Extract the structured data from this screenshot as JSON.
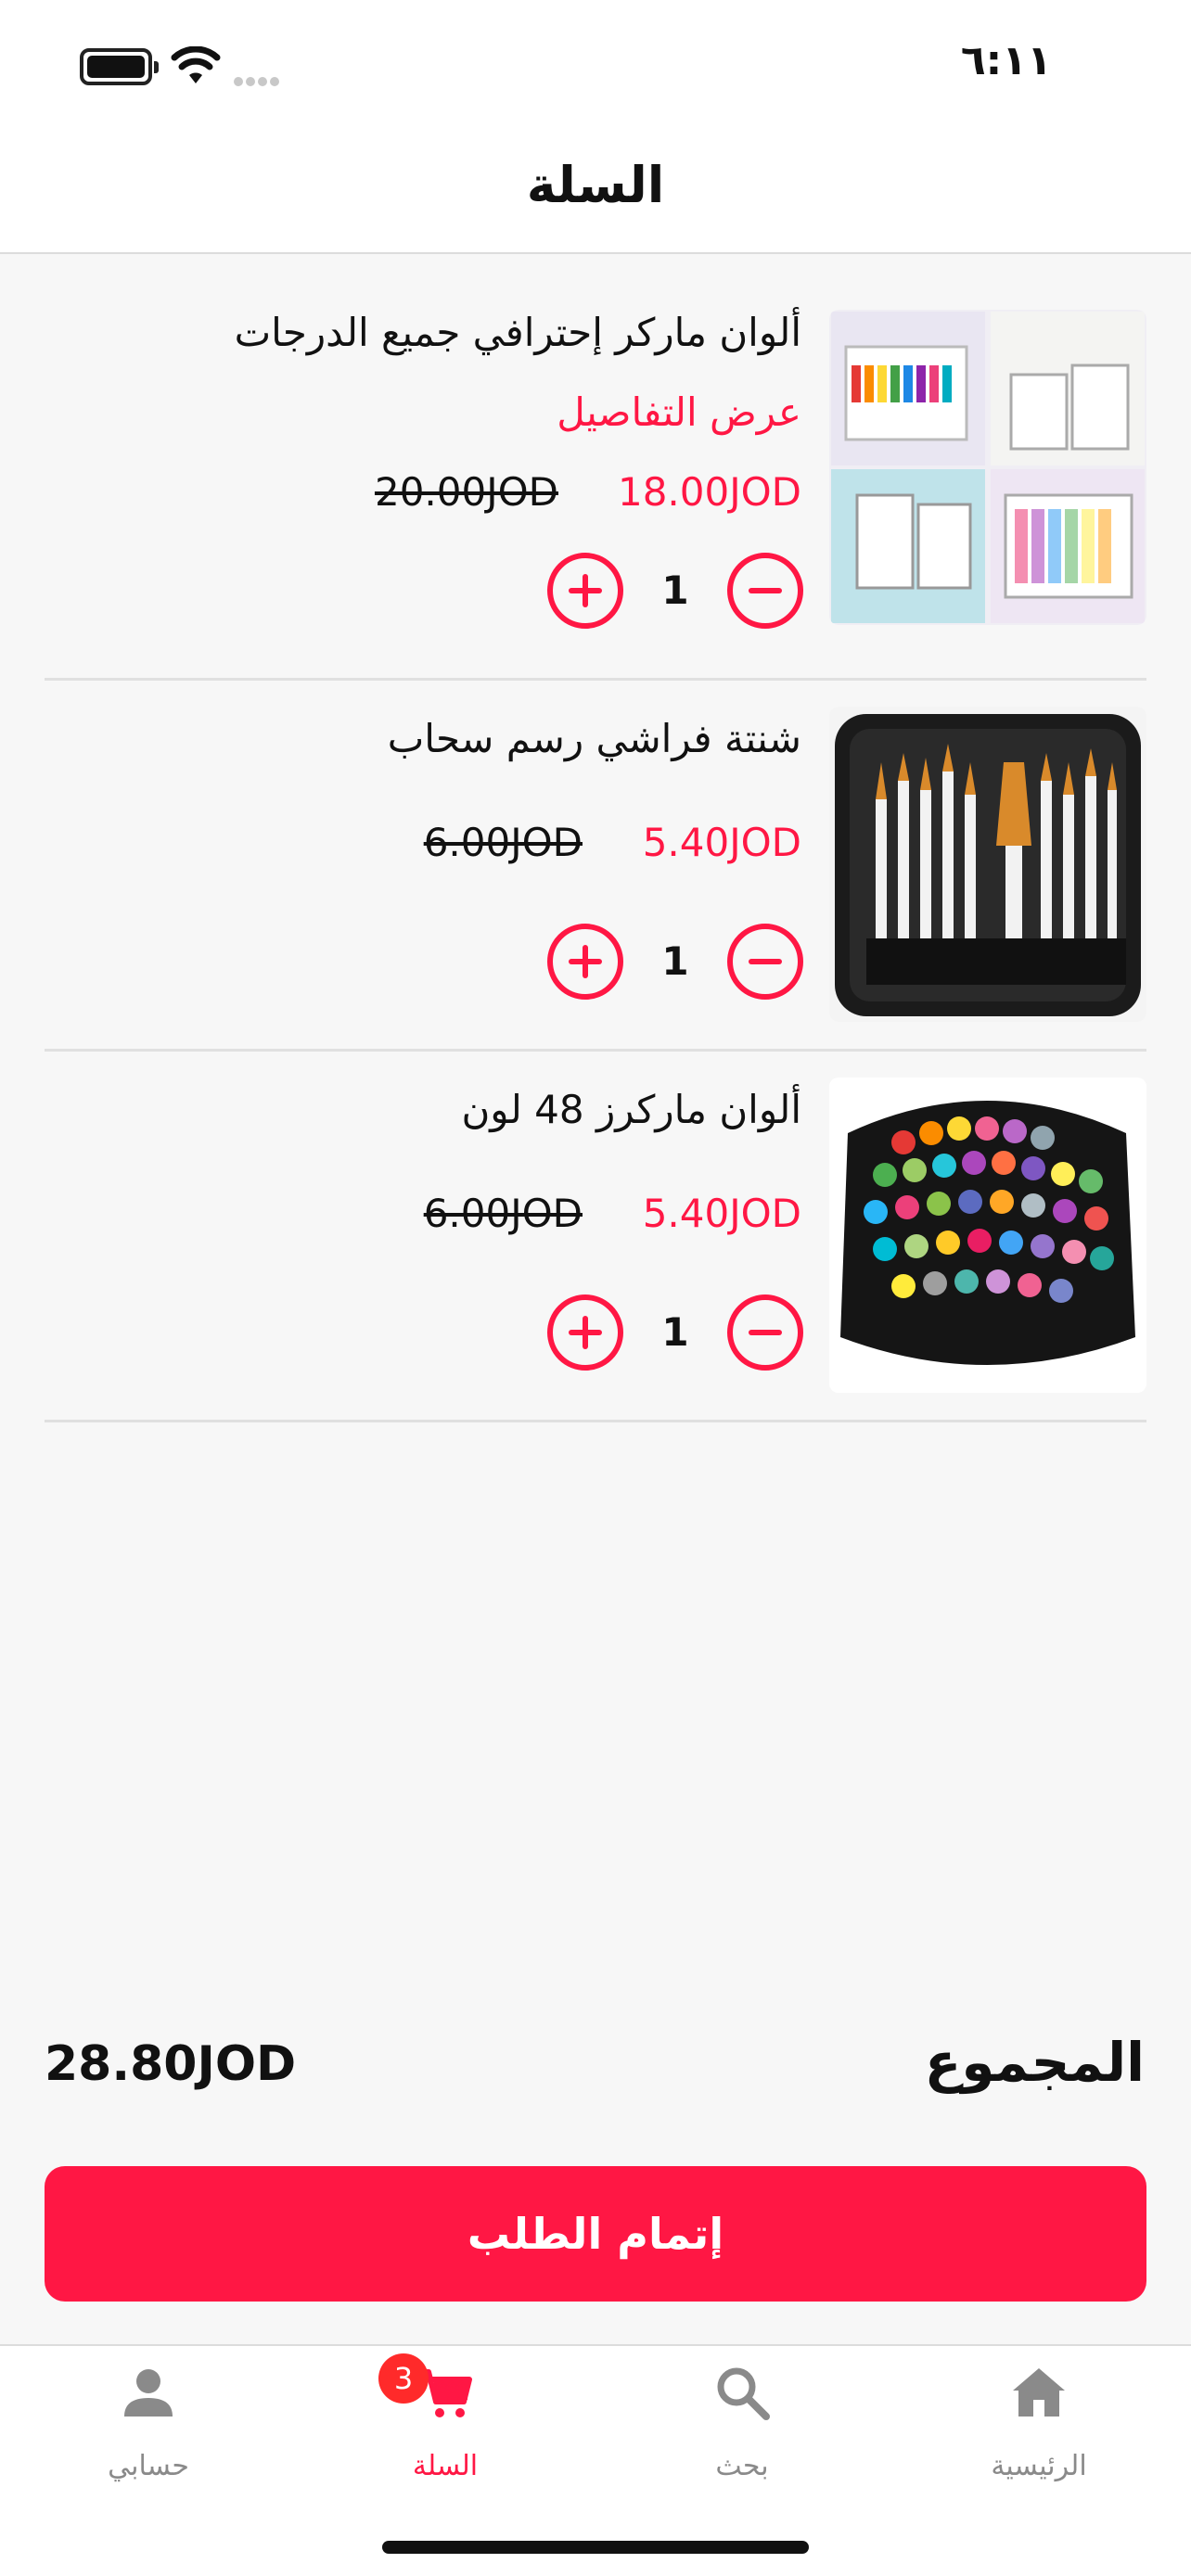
{
  "status_bar": {
    "time": "٦:١١"
  },
  "header": {
    "title": "السلة"
  },
  "cart": {
    "items": [
      {
        "title": "ألوان ماركر إحترافي جميع الدرجات",
        "details_link": "عرض التفاصيل",
        "price": "18.00JOD",
        "old_price": "20.00JOD",
        "quantity": "1",
        "image": "marker-sets-image"
      },
      {
        "title": "شنتة فراشي رسم سحاب",
        "price": "5.40JOD",
        "old_price": "6.00JOD",
        "quantity": "1",
        "image": "brush-case-image"
      },
      {
        "title": "ألوان ماركرز 48 لون",
        "price": "5.40JOD",
        "old_price": "6.00JOD",
        "quantity": "1",
        "image": "markers-48-image"
      }
    ]
  },
  "summary": {
    "total_label": "المجموع",
    "total_value": "28.80JOD"
  },
  "checkout": {
    "label": "إتمام الطلب"
  },
  "nav": {
    "items": [
      {
        "label": "حسابي",
        "icon": "person-icon"
      },
      {
        "label": "السلة",
        "icon": "cart-icon",
        "badge": "3",
        "active": true
      },
      {
        "label": "بحث",
        "icon": "search-icon"
      },
      {
        "label": "الرئيسية",
        "icon": "home-icon"
      }
    ]
  },
  "colors": {
    "accent": "#ff1744",
    "background": "#f7f7f7",
    "inactive": "#8a8a8a"
  }
}
